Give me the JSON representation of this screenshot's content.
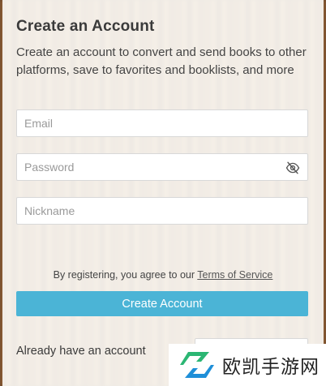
{
  "form": {
    "title": "Create an Account",
    "description": "Create an account to convert and send books to other platforms, save to favorites and booklists, and more",
    "email_placeholder": "Email",
    "password_placeholder": "Password",
    "nickname_placeholder": "Nickname",
    "terms_prefix": "By registering, you agree to our ",
    "terms_link": "Terms of Service",
    "submit_label": "Create Account",
    "already_label": "Already have an account"
  },
  "icons": {
    "password_toggle": "eye-slash-icon"
  },
  "colors": {
    "primary_button": "#4bb4d6",
    "watermark_green": "#2bb673",
    "watermark_blue": "#1f8fd8"
  },
  "watermark": {
    "text": "欧凯手游网"
  }
}
